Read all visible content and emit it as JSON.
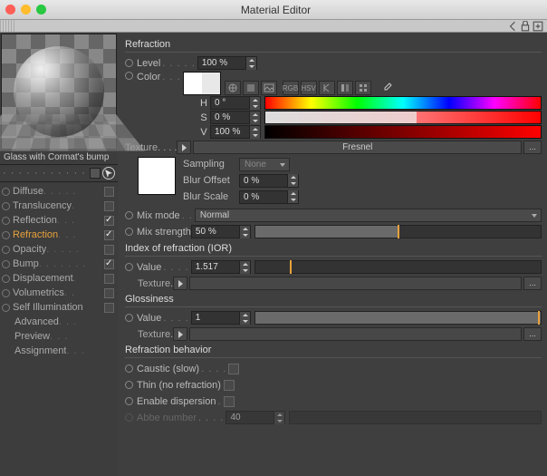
{
  "window": {
    "title": "Material Editor"
  },
  "material": {
    "name": "Glass with Cormat's bump"
  },
  "channels": [
    {
      "id": "diffuse",
      "label": "Diffuse",
      "checked": false,
      "sub": false
    },
    {
      "id": "translucency",
      "label": "Translucency",
      "checked": false,
      "sub": false
    },
    {
      "id": "reflection",
      "label": "Reflection",
      "checked": true,
      "sub": false
    },
    {
      "id": "refraction",
      "label": "Refraction",
      "checked": true,
      "sub": false,
      "selected": true
    },
    {
      "id": "opacity",
      "label": "Opacity",
      "checked": false,
      "sub": false
    },
    {
      "id": "bump",
      "label": "Bump",
      "checked": true,
      "sub": false
    },
    {
      "id": "displacement",
      "label": "Displacement",
      "checked": false,
      "sub": false
    },
    {
      "id": "volumetrics",
      "label": "Volumetrics",
      "checked": false,
      "sub": false
    },
    {
      "id": "self_illumination",
      "label": "Self Illumination",
      "checked": false,
      "sub": false
    },
    {
      "id": "advanced",
      "label": "Advanced",
      "sub": true
    },
    {
      "id": "preview",
      "label": "Preview",
      "sub": true
    },
    {
      "id": "assignment",
      "label": "Assignment",
      "sub": true
    }
  ],
  "refraction": {
    "title": "Refraction",
    "level_label": "Level",
    "level_value": "100 %",
    "color_label": "Color",
    "hsv": {
      "h_label": "H",
      "h_value": "0 °",
      "s_label": "S",
      "s_value": "0 %",
      "v_label": "V",
      "v_value": "100 %"
    },
    "texture_label": "Texture",
    "texture_value": "Fresnel",
    "tex_more": "...",
    "sampling_label": "Sampling",
    "sampling_value": "None",
    "blur_offset_label": "Blur Offset",
    "blur_offset_value": "0 %",
    "blur_scale_label": "Blur Scale",
    "blur_scale_value": "0 %",
    "mix_mode_label": "Mix mode",
    "mix_mode_value": "Normal",
    "mix_strength_label": "Mix strength",
    "mix_strength_value": "50 %",
    "icons": {
      "rgb": "RGB",
      "hsv": "HSV"
    }
  },
  "ior": {
    "title": "Index of refraction (IOR)",
    "value_label": "Value",
    "value": "1.517",
    "texture_label": "Texture",
    "tex_more": "..."
  },
  "gloss": {
    "title": "Glossiness",
    "value_label": "Value",
    "value": "1",
    "texture_label": "Texture",
    "tex_more": "..."
  },
  "behavior": {
    "title": "Refraction behavior",
    "caustic_label": "Caustic (slow)",
    "thin_label": "Thin (no refraction)",
    "dispersion_label": "Enable dispersion",
    "abbe_label": "Abbe number",
    "abbe_value": "40"
  }
}
